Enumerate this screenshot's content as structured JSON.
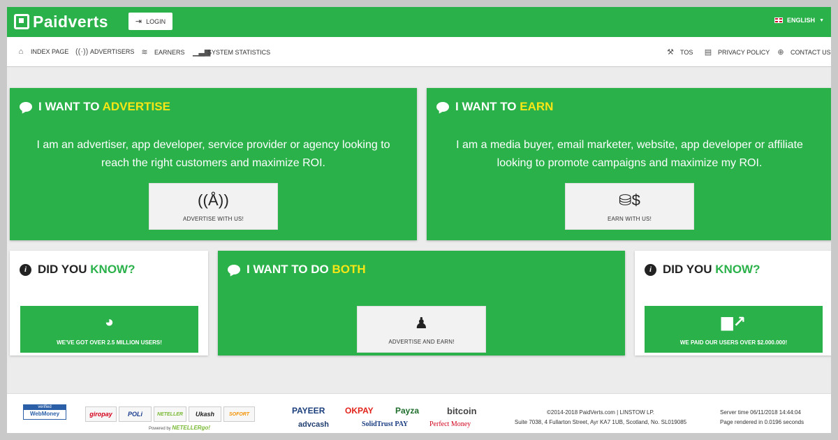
{
  "colors": {
    "brand_green": "#2ab14a",
    "highlight_yellow": "#f7e616",
    "background": "#ececec"
  },
  "header": {
    "logo_text": "Paidverts",
    "login_label": "LOGIN",
    "language": "ENGLISH"
  },
  "nav": {
    "left": [
      {
        "label": "INDEX PAGE",
        "icon": "home-icon"
      },
      {
        "label": "ADVERTISERS",
        "icon": "broadcast-icon"
      },
      {
        "label": "EARNERS",
        "icon": "coins-icon"
      },
      {
        "label": "SYSTEM STATISTICS",
        "icon": "bar-chart-icon"
      }
    ],
    "right": [
      {
        "label": "TOS",
        "icon": "gavel-icon"
      },
      {
        "label": "PRIVACY POLICY",
        "icon": "document-icon"
      },
      {
        "label": "CONTACT US",
        "icon": "lifebuoy-icon"
      }
    ]
  },
  "advertise": {
    "title_prefix": "I WANT TO",
    "title_highlight": "ADVERTISE",
    "desc_line1": "I am an advertiser, app developer, service provider or agency looking to",
    "desc_line2": "reach the right customers and maximize ROI.",
    "button": "ADVERTISE WITH US!"
  },
  "earn": {
    "title_prefix": "I WANT TO",
    "title_highlight": "EARN",
    "desc_line1": "I am a media buyer, email marketer, website, app developer or affiliate",
    "desc_line2": "looking to promote campaigns and maximize my ROI.",
    "button": "EARN WITH US!"
  },
  "both": {
    "title_prefix": "I WANT TO DO",
    "title_highlight": "BOTH",
    "button": "ADVERTISE AND EARN!"
  },
  "know_left": {
    "title_prefix": "DID YOU",
    "title_highlight": "KNOW?",
    "stat": "WE'VE GOT OVER 2.5 MILLION USERS!"
  },
  "know_right": {
    "title_prefix": "DID YOU",
    "title_highlight": "KNOW?",
    "stat": "WE PAID OUR USERS OVER $2.000.000!"
  },
  "footer": {
    "webmoney_top": "verified",
    "webmoney_name": "WebMoney",
    "payment_logos": [
      "giropay",
      "POLi",
      "NETELLER",
      "Ukash",
      "SOFORT"
    ],
    "powered_prefix": "Powered by",
    "powered_brand": "NETELLERgo!",
    "brands": [
      "PAYEER",
      "OKPAY",
      "Payza",
      "bitcoin",
      "advcash",
      "SolidTrust PAY",
      "Perfect Money"
    ],
    "copyright_line1": "©2014-2018 PaidVerts.com | LINSTOW LP.",
    "copyright_line2": "Suite 7038, 4 Fullarton Street, Ayr KA7 1UB, Scotland, No. SL019085",
    "server_time": "Server time 06/11/2018 14:44:04",
    "render_time": "Page rendered in 0.0196 seconds"
  }
}
